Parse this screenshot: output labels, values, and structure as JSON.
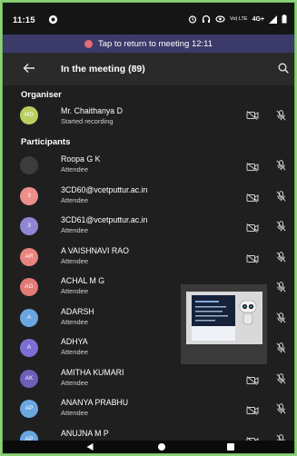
{
  "status_bar": {
    "time": "11:15",
    "icons": [
      "sync-icon",
      "headset-icon",
      "cast-icon"
    ],
    "lte_label": "Vo) LTE",
    "network": "4G+",
    "signal_icon": "signal-icon",
    "battery_icon": "battery-icon"
  },
  "banner": {
    "text": "Tap to return to meeting 12:11",
    "dot_color": "#e26b75"
  },
  "header": {
    "title": "In the meeting (89)",
    "back_icon": "arrow-left-icon",
    "search_icon": "search-icon"
  },
  "sections": {
    "organiser": "Organiser",
    "participants": "Participants"
  },
  "organiser": {
    "initials": "MD",
    "name": "Mr. Chaithanya  D",
    "role": "Started recording",
    "color": "#b9cf60"
  },
  "participants": [
    {
      "initials": "",
      "name": "Roopa G K",
      "role": "Attendee",
      "color": "#3c3c3c"
    },
    {
      "initials": "3",
      "name": "3CD60@vcetputtur.ac.in",
      "role": "Attendee",
      "color": "#ec8e8a"
    },
    {
      "initials": "3",
      "name": "3CD61@vcetputtur.ac.in",
      "role": "Attendee",
      "color": "#8f86d4"
    },
    {
      "initials": "AR",
      "name": "A VAISHNAVI RAO",
      "role": "Attendee",
      "color": "#e8847e"
    },
    {
      "initials": "AG",
      "name": "ACHAL M G",
      "role": "Attendee",
      "color": "#e27a77"
    },
    {
      "initials": "A",
      "name": "ADARSH",
      "role": "Attendee",
      "color": "#6aa6e0"
    },
    {
      "initials": "A",
      "name": "ADHYA",
      "role": "Attendee",
      "color": "#7c6fd4"
    },
    {
      "initials": "AK",
      "name": "AMITHA KUMARI",
      "role": "Attendee",
      "color": "#6c5fb8"
    },
    {
      "initials": "AP",
      "name": "ANANYA PRABHU",
      "role": "Attendee",
      "color": "#6aa6e0"
    },
    {
      "initials": "AP",
      "name": "ANUJNA M P",
      "role": "Attendee",
      "color": "#6aa6e0"
    }
  ],
  "nav_bar": {
    "icons": [
      "back-triangle-icon",
      "home-circle-icon",
      "recents-square-icon"
    ]
  }
}
